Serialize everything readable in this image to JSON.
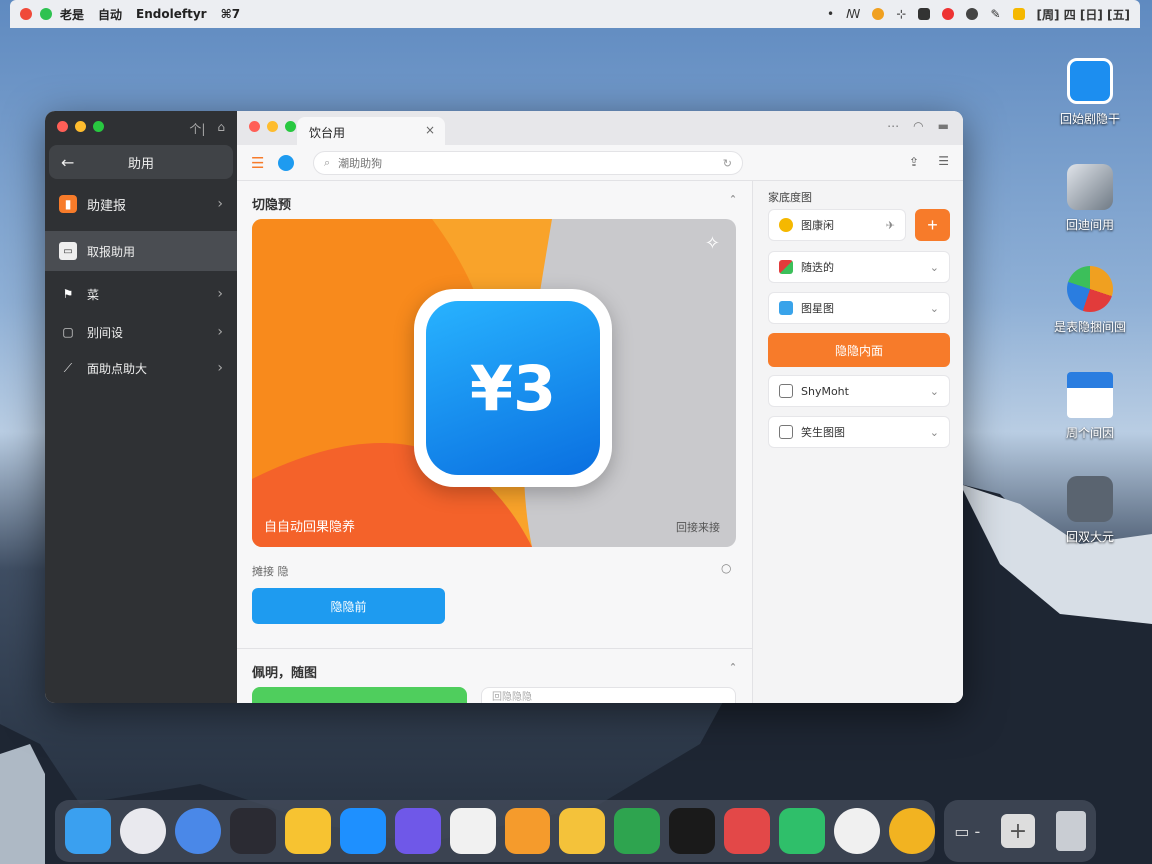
{
  "menubar": {
    "app_name": "老是",
    "items": [
      "自动",
      "Endoleftyr",
      "⌘7"
    ],
    "clock": "[周] 四 [日] [五]"
  },
  "desktop_icons": [
    {
      "label": "回始剧隐干",
      "color": "#1c8ef0"
    },
    {
      "label": "回迪间用",
      "color": "#6f7a85"
    },
    {
      "label": "是表隐捆间囤",
      "color": "#f0a020"
    },
    {
      "label": "周个间因",
      "color": "#2a7de0"
    },
    {
      "label": "回双大元",
      "color": "#5a6470"
    }
  ],
  "sidebar": {
    "back_title": "助用",
    "items": [
      {
        "label": "助建报",
        "icon": "app-icon",
        "chevron": true,
        "active": false
      },
      {
        "label": "取报助用",
        "icon": "tray-icon",
        "chevron": false,
        "active": true
      },
      {
        "label": "菜",
        "icon": "flag-icon",
        "chevron": true,
        "active": false
      },
      {
        "label": "别间设",
        "icon": "window-icon",
        "chevron": true,
        "active": false
      },
      {
        "label": "面助点助大",
        "icon": "brush-icon",
        "chevron": true,
        "active": false
      }
    ],
    "tools": [
      "个|",
      "⌂"
    ]
  },
  "tab": {
    "title": "饮台用"
  },
  "search": {
    "placeholder": "潮助助狗"
  },
  "section1": {
    "title": "切隐预",
    "banner_left_caption": "自自动回果隐养",
    "banner_right_caption": "回接来接",
    "banner_app_text": "¥3",
    "below_label": "摊接 隐",
    "button_label": "隐隐前"
  },
  "section2": {
    "title": "佩明，随图",
    "input_placeholder": "回隐隐隐"
  },
  "right_panel": {
    "header": "家底度图",
    "rows": [
      {
        "label": "图康闲",
        "icon_color": "#f5b800",
        "type": "plus"
      },
      {
        "label": "随迭的",
        "icon_color": "#e23b3b",
        "type": "chevron"
      },
      {
        "label": "图星图",
        "icon_color": "#39a3ea",
        "type": "chevron"
      },
      {
        "label": "ShyMoht",
        "icon_color": "#777777",
        "type": "chevron"
      },
      {
        "label": "笑生图图",
        "icon_color": "#777777",
        "type": "chevron"
      }
    ],
    "primary_button": "隐隐内面"
  },
  "dock": [
    {
      "name": "finder",
      "color": "#3aa0f0"
    },
    {
      "name": "color-picker",
      "color": "#e9e9ee"
    },
    {
      "name": "chrome",
      "color": "#4a88e8"
    },
    {
      "name": "music",
      "color": "#2b2b33"
    },
    {
      "name": "notes",
      "color": "#f7c331"
    },
    {
      "name": "app-store",
      "color": "#1e90ff"
    },
    {
      "name": "maps",
      "color": "#6f58e8"
    },
    {
      "name": "notes-list",
      "color": "#f1f1f1"
    },
    {
      "name": "tools",
      "color": "#f59b2c"
    },
    {
      "name": "files",
      "color": "#f4c23a"
    },
    {
      "name": "numbers",
      "color": "#2ea44f"
    },
    {
      "name": "game",
      "color": "#1a1a1a"
    },
    {
      "name": "pay",
      "color": "#e34848"
    },
    {
      "name": "phone",
      "color": "#2fbf6a"
    },
    {
      "name": "spinner",
      "color": "#f0f0f0"
    },
    {
      "name": "photos",
      "color": "#f2b321"
    }
  ],
  "colors": {
    "accent_orange": "#f77b2a",
    "accent_blue": "#1e9bf0",
    "accent_green": "#4fce5d"
  }
}
